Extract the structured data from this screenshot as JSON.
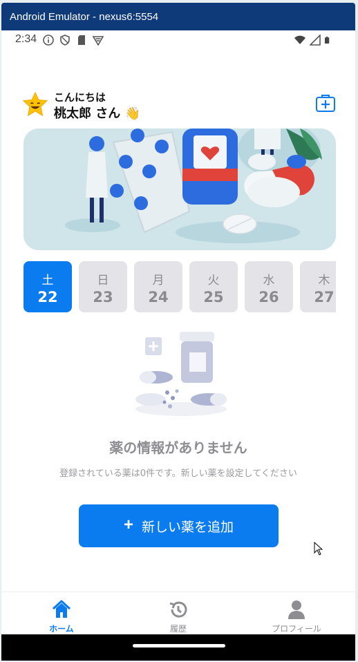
{
  "window": {
    "title": "Android Emulator - nexus6:5554"
  },
  "status_bar": {
    "time": "2:34"
  },
  "header": {
    "greeting": "こんにちは",
    "user_name": "桃太郎 さん 👋"
  },
  "days": [
    {
      "weekday": "土",
      "date": "22",
      "selected": true
    },
    {
      "weekday": "日",
      "date": "23",
      "selected": false
    },
    {
      "weekday": "月",
      "date": "24",
      "selected": false
    },
    {
      "weekday": "火",
      "date": "25",
      "selected": false
    },
    {
      "weekday": "水",
      "date": "26",
      "selected": false
    },
    {
      "weekday": "木",
      "date": "27",
      "selected": false
    }
  ],
  "empty_state": {
    "title": "薬の情報がありません",
    "subtitle": "登録されている薬は0件です。新しい薬を設定してください"
  },
  "add_button": {
    "icon": "+",
    "label": "新しい薬を追加"
  },
  "tabs": [
    {
      "label": "ホーム",
      "icon": "home-icon",
      "active": true
    },
    {
      "label": "履歴",
      "icon": "history-icon",
      "active": false
    },
    {
      "label": "プロフィール",
      "icon": "person-icon",
      "active": false
    }
  ],
  "colors": {
    "accent": "#0b7cf0",
    "muted": "#8d8d92",
    "chip": "#e4e4e8",
    "titlebar": "#0f3a7a"
  }
}
